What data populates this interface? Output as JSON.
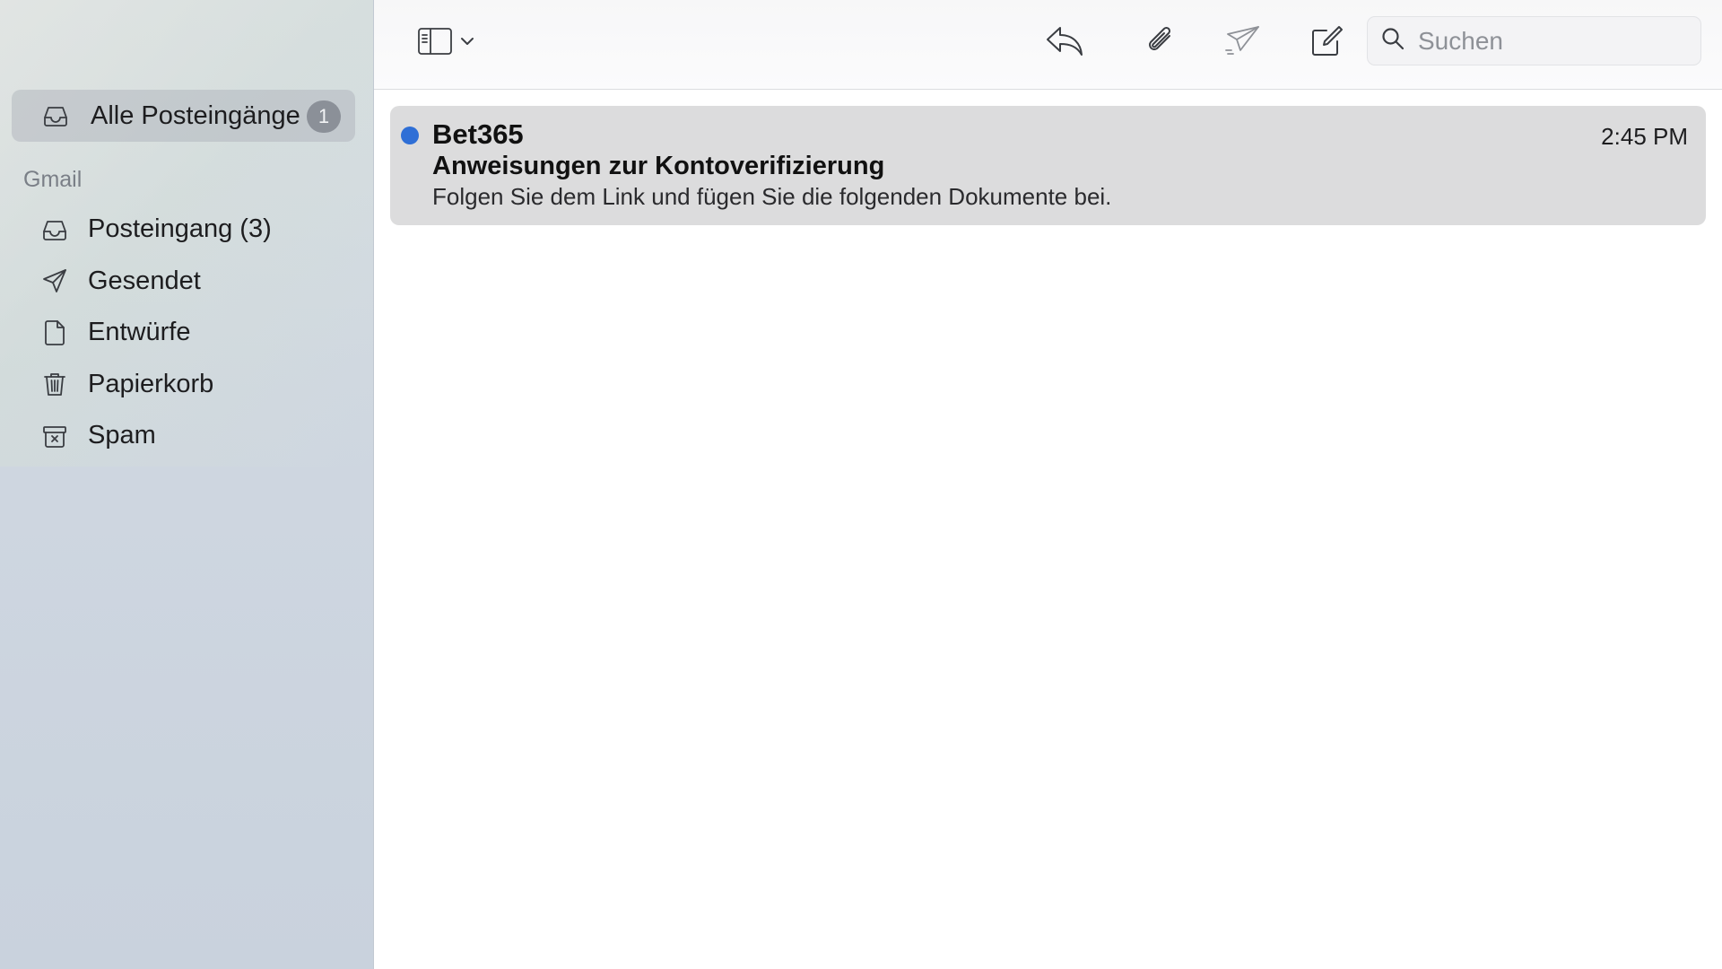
{
  "sidebar": {
    "all_inboxes": {
      "label": "Alle Posteingänge",
      "badge": "1",
      "icon": "tray-icon"
    },
    "account_header": "Gmail",
    "folders": [
      {
        "label": "Posteingang (3)",
        "icon": "tray-icon"
      },
      {
        "label": "Gesendet",
        "icon": "paper-plane-icon"
      },
      {
        "label": "Entwürfe",
        "icon": "document-icon"
      },
      {
        "label": "Papierkorb",
        "icon": "trash-icon"
      },
      {
        "label": "Spam",
        "icon": "junk-box-icon"
      }
    ]
  },
  "toolbar": {
    "buttons": [
      "sidebar-toggle-icon",
      "chevron-down-icon",
      "reply-icon",
      "paperclip-icon",
      "send-icon",
      "compose-icon"
    ],
    "search": {
      "placeholder": "Suchen",
      "value": ""
    }
  },
  "messages": [
    {
      "sender": "Bet365",
      "time": "2:45 PM",
      "subject": "Anweisungen zur Kontoverifizierung",
      "preview": "Folgen Sie dem Link und fügen Sie die folgenden Dokumente bei.",
      "unread": true
    }
  ],
  "colors": {
    "unread_dot": "#2f6fd6",
    "selected_row": "#dcdcdd",
    "badge": "#8b9098"
  }
}
